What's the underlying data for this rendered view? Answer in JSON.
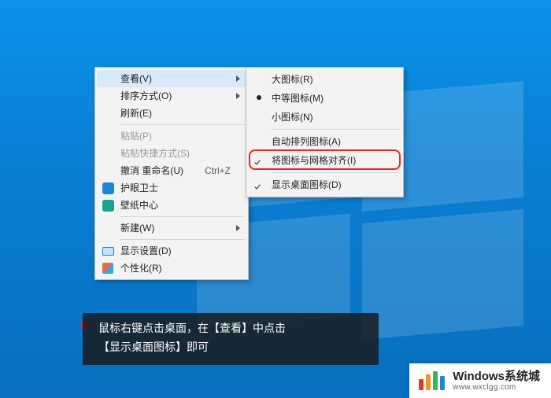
{
  "desktop": {
    "context_menu": {
      "items": [
        {
          "label": "查看(V)",
          "has_sub": true,
          "hover": true
        },
        {
          "label": "排序方式(O)",
          "has_sub": true
        },
        {
          "label": "刷新(E)"
        },
        {
          "sep": true
        },
        {
          "label": "粘贴(P)",
          "disabled": true
        },
        {
          "label": "粘贴快捷方式(S)",
          "disabled": true
        },
        {
          "label": "撤消 重命名(U)",
          "accel": "Ctrl+Z"
        },
        {
          "label": "护眼卫士",
          "icon": "blue"
        },
        {
          "label": "壁纸中心",
          "icon": "teal"
        },
        {
          "sep": true
        },
        {
          "label": "新建(W)",
          "has_sub": true
        },
        {
          "sep": true
        },
        {
          "label": "显示设置(D)",
          "icon": "disp"
        },
        {
          "label": "个性化(R)",
          "icon": "pers"
        }
      ]
    },
    "view_submenu": {
      "items": [
        {
          "label": "大图标(R)"
        },
        {
          "label": "中等图标(M)",
          "radio": true
        },
        {
          "label": "小图标(N)"
        },
        {
          "sep": true
        },
        {
          "label": "自动排列图标(A)"
        },
        {
          "label": "将图标与网格对齐(I)",
          "check": true
        },
        {
          "sep": true
        },
        {
          "label": "显示桌面图标(D)",
          "check": true,
          "highlight": true
        }
      ]
    }
  },
  "caption": {
    "line1": "鼠标右键点击桌面，在【查看】中点击",
    "line2": "【显示桌面图标】即可"
  },
  "watermark": {
    "title": "Windows系统城",
    "url": "www.wxclgg.com"
  }
}
